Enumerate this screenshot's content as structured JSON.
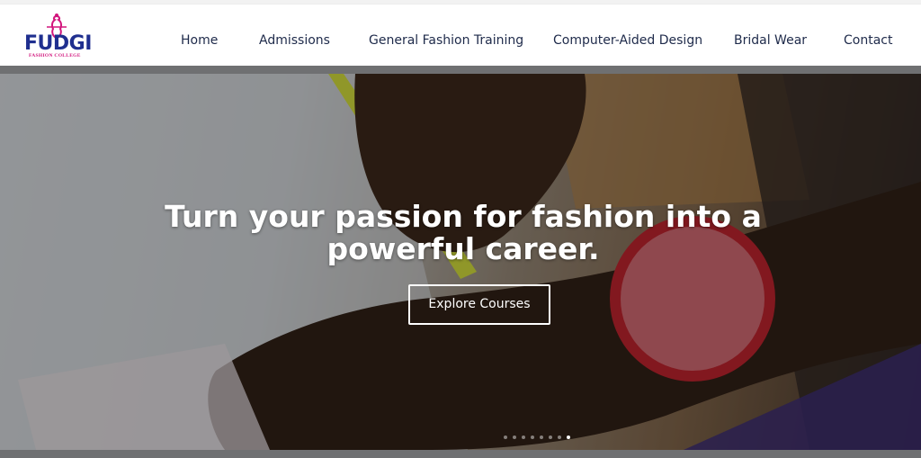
{
  "brand": {
    "name": "FUDGI",
    "tagline": "FASHION COLLEGE",
    "logo_color": "#1f2f8f",
    "accent_color": "#d2167d"
  },
  "nav": {
    "items": [
      {
        "label": "Home"
      },
      {
        "label": "Admissions"
      },
      {
        "label": "General Fashion Training"
      },
      {
        "label": "Computer-Aided Design"
      },
      {
        "label": "Bridal Wear"
      },
      {
        "label": "Contact"
      }
    ]
  },
  "hero": {
    "title": "Turn your passion for fashion into a powerful career.",
    "cta_label": "Explore Courses",
    "slide_count": 8,
    "active_slide": 7
  }
}
